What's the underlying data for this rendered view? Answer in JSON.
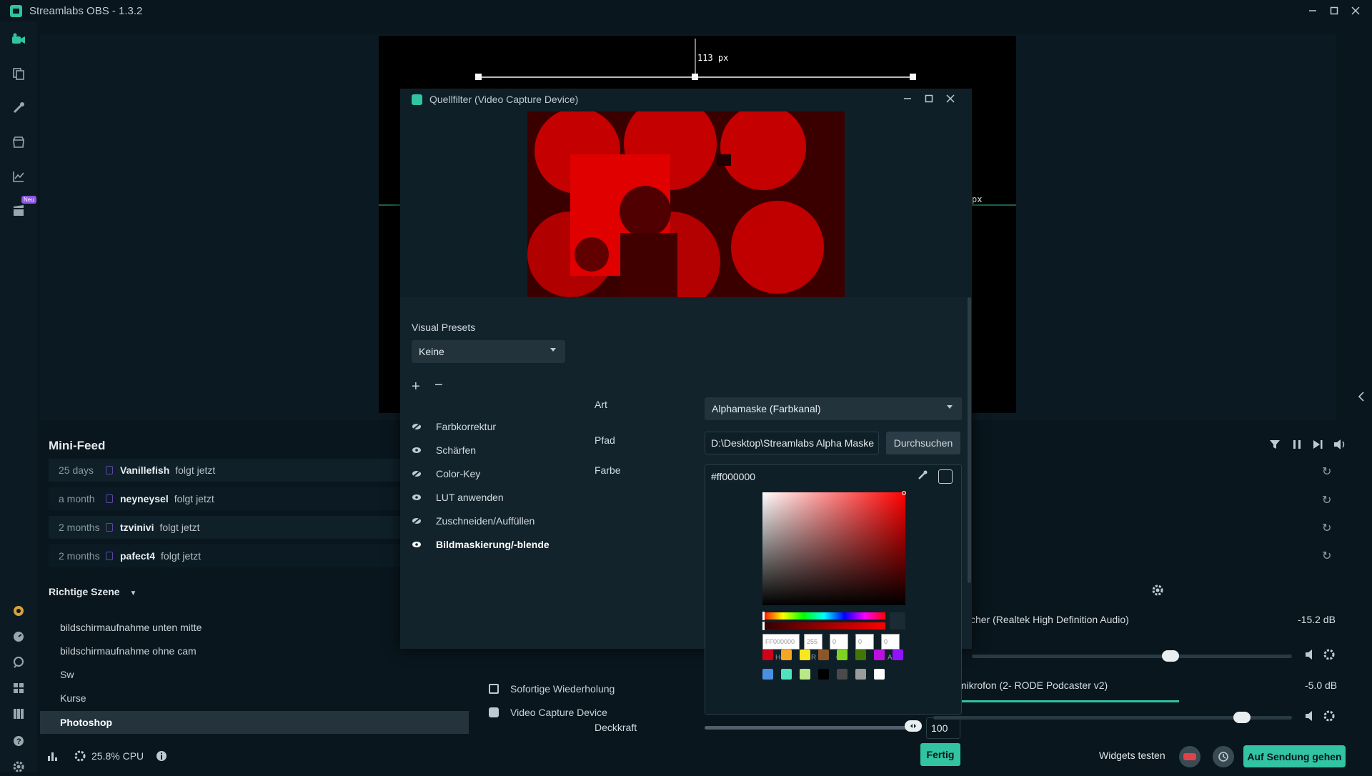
{
  "window": {
    "title": "Streamlabs OBS - 1.3.2"
  },
  "sidebar": {
    "new_badge": "Neu"
  },
  "canvas": {
    "top_measure": "113 px",
    "side_measure": "px"
  },
  "mini_feed": {
    "title": "Mini-Feed",
    "items": [
      {
        "time": "25 days",
        "user": "Vanillefish",
        "action": "folgt jetzt"
      },
      {
        "time": "a month",
        "user": "neyneysel",
        "action": "folgt jetzt"
      },
      {
        "time": "2 months",
        "user": "tzvinivi",
        "action": "folgt jetzt"
      },
      {
        "time": "2 months",
        "user": "pafect4",
        "action": "folgt jetzt"
      }
    ]
  },
  "scenes": {
    "title": "Richtige Szene",
    "items": [
      {
        "label": "bildschirmaufnahme unten mitte"
      },
      {
        "label": "bildschirmaufnahme ohne cam"
      },
      {
        "label": "Sw"
      },
      {
        "label": "Kurse"
      },
      {
        "label": "Photoshop",
        "active": true
      }
    ]
  },
  "sources": {
    "items": [
      {
        "label": "Sofortige Wiederholung"
      },
      {
        "label": "Video Capture Device"
      }
    ]
  },
  "mixer": {
    "items": [
      {
        "name": "cher (Realtek High Definition Audio)",
        "db": "-15.2 dB",
        "level": 0.62
      },
      {
        "name": "Tischmikrofon (2- RODE Podcaster v2)",
        "db": "-5.0 dB",
        "level": 0.86
      }
    ]
  },
  "footer": {
    "cpu": "25.8% CPU",
    "widgets_test": "Widgets testen",
    "go_live": "Auf Sendung gehen"
  },
  "dialog": {
    "title": "Quellfilter (Video Capture Device)",
    "visual_presets_label": "Visual Presets",
    "visual_presets_value": "Keine",
    "add_symbol": "+",
    "remove_symbol": "−",
    "filters": [
      {
        "label": "Farbkorrektur",
        "icon": "eye-slash-icon"
      },
      {
        "label": "Schärfen",
        "icon": "eye-icon"
      },
      {
        "label": "Color-Key",
        "icon": "eye-slash-icon"
      },
      {
        "label": "LUT anwenden",
        "icon": "eye-icon"
      },
      {
        "label": "Zuschneiden/Auffüllen",
        "icon": "eye-slash-icon"
      },
      {
        "label": "Bildmaskierung/-blende",
        "icon": "eye-icon",
        "active": true
      }
    ],
    "props": {
      "art_label": "Art",
      "art_value": "Alphamaske (Farbkanal)",
      "pfad_label": "Pfad",
      "pfad_value": "D:\\Desktop\\Streamlabs Alpha Maske",
      "browse_label": "Durchsuchen",
      "farbe_label": "Farbe",
      "color_hex": "#ff000000",
      "picker": {
        "hex_placeholder": "FF000000",
        "r": "255",
        "g": "0",
        "b": "0",
        "a": "0",
        "labels": {
          "hex": "Hex",
          "r": "R",
          "g": "G",
          "b": "B",
          "a": "A"
        },
        "swatches_row1": [
          "#d0021b",
          "#f5a623",
          "#f8e71c",
          "#8b572a",
          "#7ed321",
          "#417505",
          "#bd10e0",
          "#9013fe"
        ],
        "swatches_row2": [
          "#4a90e2",
          "#50e3c2",
          "#b8e986",
          "#000000",
          "#4a4a4a",
          "#9b9b9b",
          "#ffffff"
        ]
      },
      "opacity_label": "Deckkraft",
      "opacity_value": "100",
      "opacity_level": 1.0,
      "done_label": "Fertig"
    }
  },
  "colors": {
    "accent": "#31c3a2",
    "background": "#09161d",
    "panel": "#13232b"
  }
}
